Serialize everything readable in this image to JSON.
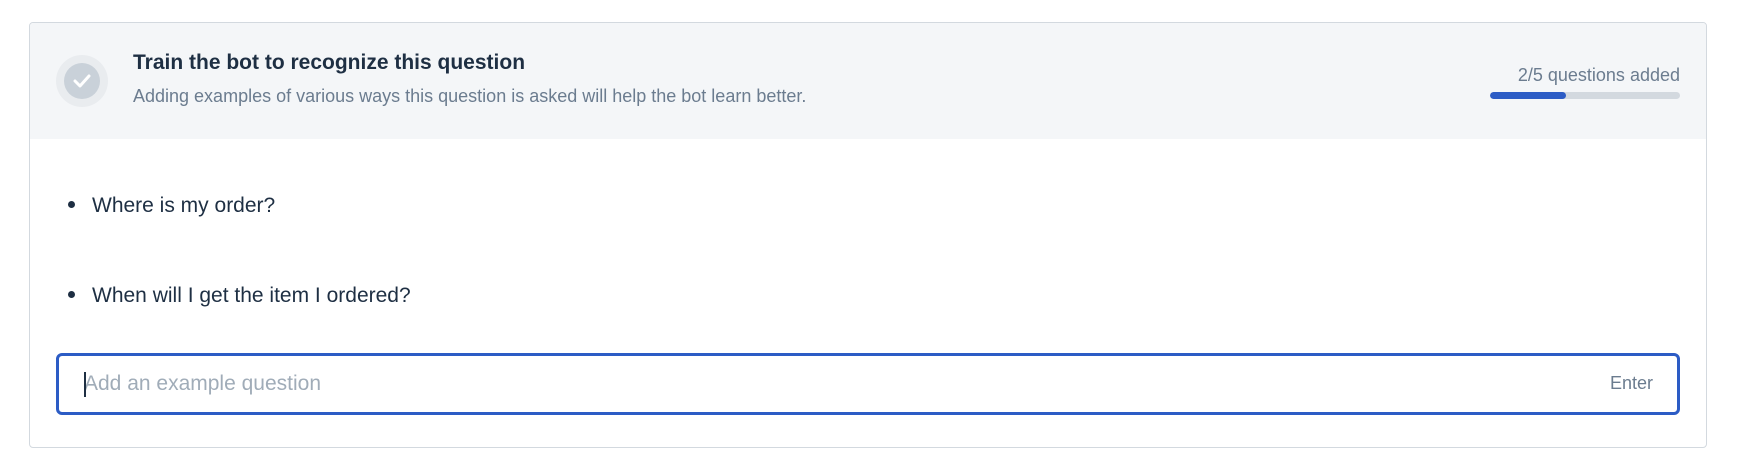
{
  "header": {
    "title": "Train the bot to recognize this question",
    "subtitle": "Adding examples of various ways this question is asked will help the bot learn better.",
    "icon": "check-icon"
  },
  "progress": {
    "label": "2/5 questions added",
    "added": 2,
    "total": 5,
    "fraction": 0.4,
    "color": "#2c5cc5"
  },
  "questions": [
    {
      "text": "Where is my order?"
    },
    {
      "text": "When will I get the item I ordered?"
    }
  ],
  "input": {
    "value": "",
    "placeholder": "Add an example question",
    "hint": "Enter"
  }
}
